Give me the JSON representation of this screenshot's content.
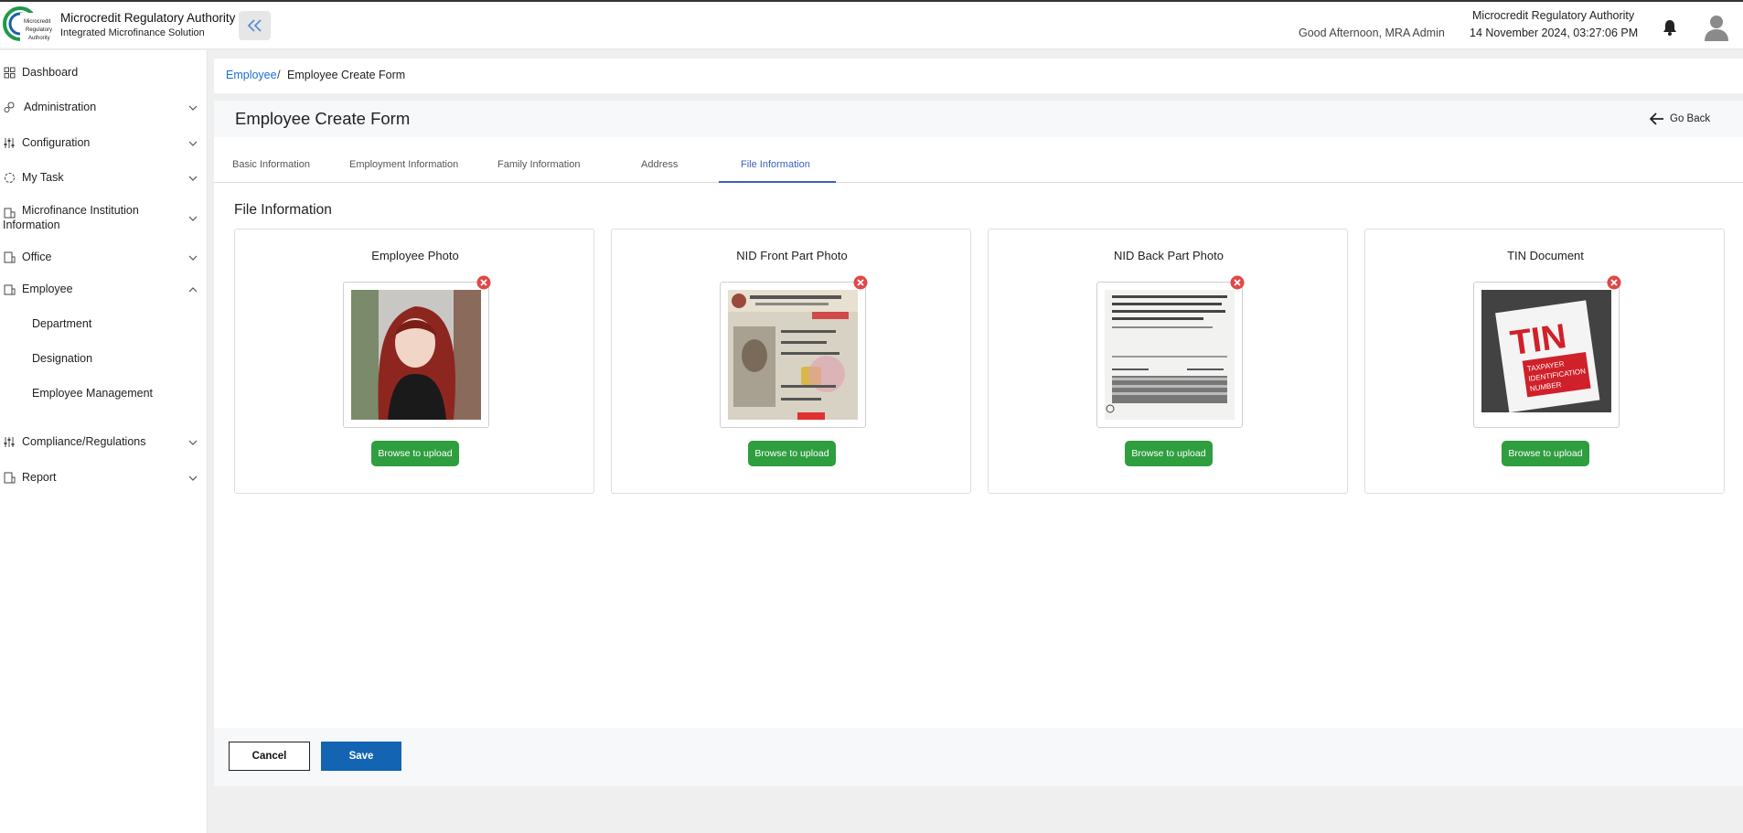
{
  "header": {
    "app_title": "Microcredit Regulatory Authority",
    "app_subtitle": "Integrated Microfinance Solution",
    "greeting": "Good Afternoon, MRA Admin",
    "org_name": "Microcredit Regulatory Authority",
    "datetime": "14 November 2024, 03:27:06 PM",
    "logo_text": [
      "Microcredit",
      "Regulatory",
      "Authority"
    ]
  },
  "sidebar": {
    "items": [
      {
        "label": "Dashboard",
        "icon": "grid-icon"
      },
      {
        "label": "Administration",
        "icon": "users-gear-icon"
      },
      {
        "label": "Configuration",
        "icon": "sliders-icon"
      },
      {
        "label": "My Task",
        "icon": "task-circle-icon"
      },
      {
        "label": "Microfinance Institution",
        "label2": "Information",
        "icon": "building-icon"
      },
      {
        "label": "Office",
        "icon": "office-icon"
      },
      {
        "label": "Employee",
        "icon": "employee-icon"
      },
      {
        "label": "Compliance/Regulations",
        "icon": "sliders-icon"
      },
      {
        "label": "Report",
        "icon": "report-icon"
      }
    ],
    "employee_sub": [
      "Department",
      "Designation",
      "Employee Management"
    ]
  },
  "breadcrumb": {
    "parent": "Employee",
    "separator": "/",
    "current": "Employee Create Form"
  },
  "page": {
    "title": "Employee Create Form",
    "go_back": "Go Back",
    "tabs": [
      "Basic Information",
      "Employment Information",
      "Family Information",
      "Address",
      "File Information"
    ],
    "active_tab": "File Information",
    "section_title": "File Information",
    "cards": [
      {
        "title": "Employee Photo",
        "button": "Browse to upload"
      },
      {
        "title": "NID Front Part Photo",
        "button": "Browse to upload"
      },
      {
        "title": "NID Back Part Photo",
        "button": "Browse to upload"
      },
      {
        "title": "TIN Document",
        "button": "Browse to upload"
      }
    ],
    "tin_image_text": [
      "TIN",
      "TAXPAYER",
      "IDENTIFICATION",
      "NUMBER"
    ],
    "cancel": "Cancel",
    "save": "Save"
  },
  "colors": {
    "accent": "#1a6fd6",
    "active_tab": "#3b5fc0",
    "upload_green": "#2e9e3f",
    "save_blue": "#1464b4",
    "remove_red": "#e04848"
  }
}
